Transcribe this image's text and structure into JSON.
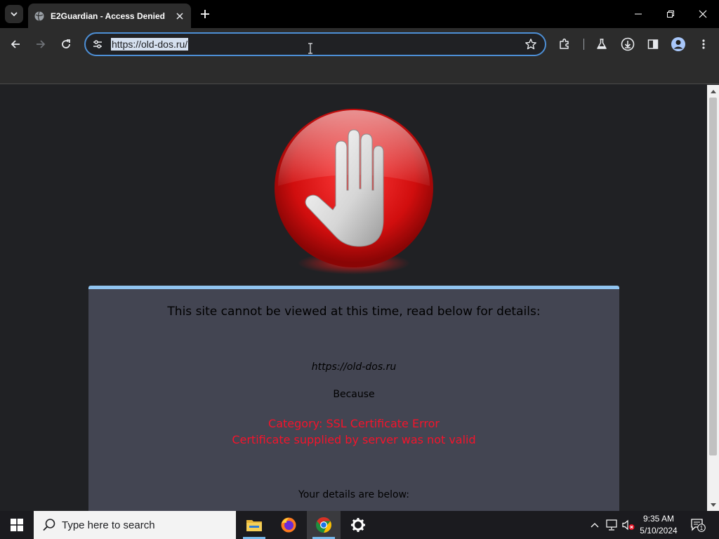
{
  "browser": {
    "tab_title": "E2Guardian - Access Denied",
    "url": "https://old-dos.ru/"
  },
  "page": {
    "heading": "This site cannot be viewed at this time, read below for details:",
    "blocked_url": "https://old-dos.ru",
    "because_label": "Because",
    "category": "Category: SSL Certificate Error",
    "reason": "Certificate supplied by server was not valid",
    "details_label": "Your details are below:"
  },
  "taskbar": {
    "search_placeholder": "Type here to search",
    "time": "9:35 AM",
    "date": "5/10/2024",
    "notification_count": "1"
  },
  "colors": {
    "error_text": "#f5132b",
    "panel_bg": "#434552",
    "panel_accent": "#90c4f0",
    "omnibox_focus": "#4d8fd6"
  },
  "icons": [
    "tab-search-icon",
    "globe-icon",
    "close-icon",
    "plus-icon",
    "minimize-icon",
    "restore-icon",
    "back-icon",
    "forward-icon",
    "reload-icon",
    "tune-icon",
    "star-icon",
    "extensions-icon",
    "labs-icon",
    "download-icon",
    "side-panel-icon",
    "profile-icon",
    "more-icon",
    "stop-hand-icon",
    "windows-logo-icon",
    "search-icon",
    "file-explorer-icon",
    "firefox-icon",
    "chrome-icon",
    "settings-icon",
    "chevron-up-icon",
    "network-icon",
    "volume-muted-icon",
    "notification-icon"
  ]
}
